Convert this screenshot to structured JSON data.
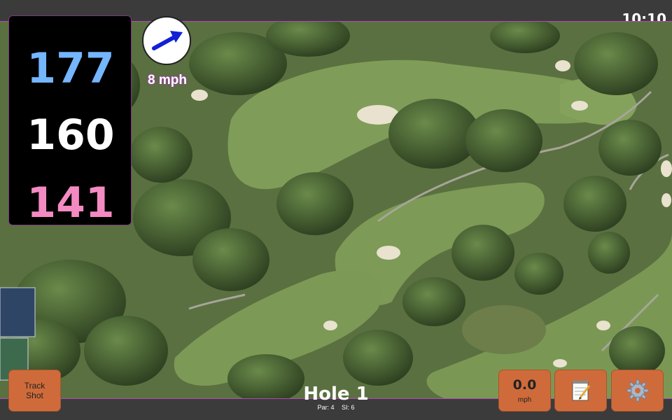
{
  "status": {
    "clock": "10:10"
  },
  "distances": {
    "back": "177",
    "middle": "160",
    "front": "141"
  },
  "wind": {
    "speed": "8 mph",
    "direction_icon": "arrow-icon"
  },
  "hole": {
    "title": "Hole 1",
    "par": "Par: 4",
    "si": "SI: 6"
  },
  "buttons": {
    "track_line1": "Track",
    "track_line2": "Shot",
    "speed_value": "0.0",
    "speed_unit": "mph",
    "notes_icon": "notepad-icon",
    "settings_icon": "gear-icon"
  },
  "colors": {
    "back_distance": "#74b6ff",
    "middle_distance": "#ffffff",
    "front_distance": "#f48ac2",
    "button": "#cf6b3b",
    "accent": "#b14bb5"
  }
}
